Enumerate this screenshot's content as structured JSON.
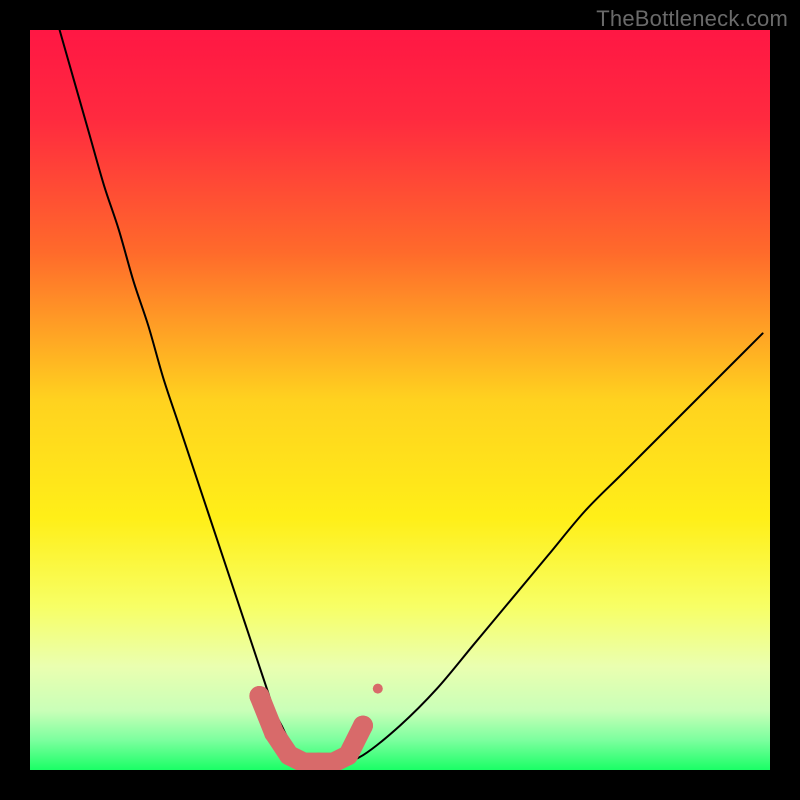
{
  "watermark": "TheBottleneck.com",
  "chart_data": {
    "type": "line",
    "title": "",
    "xlabel": "",
    "ylabel": "",
    "xlim": [
      0,
      100
    ],
    "ylim": [
      0,
      100
    ],
    "grid": false,
    "legend": false,
    "background_gradient": [
      {
        "stop": 0.0,
        "color": "#ff1744"
      },
      {
        "stop": 0.12,
        "color": "#ff2a3f"
      },
      {
        "stop": 0.3,
        "color": "#ff6a2b"
      },
      {
        "stop": 0.5,
        "color": "#ffd21f"
      },
      {
        "stop": 0.66,
        "color": "#ffef18"
      },
      {
        "stop": 0.78,
        "color": "#f7ff66"
      },
      {
        "stop": 0.86,
        "color": "#eaffb0"
      },
      {
        "stop": 0.92,
        "color": "#c9ffb8"
      },
      {
        "stop": 0.96,
        "color": "#7bff9e"
      },
      {
        "stop": 1.0,
        "color": "#1aff66"
      }
    ],
    "series": [
      {
        "name": "bottleneck-curve",
        "stroke": "#000000",
        "stroke_width": 2,
        "x": [
          4,
          6,
          8,
          10,
          12,
          14,
          16,
          18,
          20,
          22,
          24,
          26,
          28,
          29,
          30,
          31,
          32,
          33,
          34,
          35,
          36,
          37,
          38,
          39,
          40,
          42,
          45,
          50,
          55,
          60,
          65,
          70,
          75,
          80,
          85,
          90,
          95,
          99
        ],
        "values": [
          100,
          93,
          86,
          79,
          73,
          66,
          60,
          53,
          47,
          41,
          35,
          29,
          23,
          20,
          17,
          14,
          11,
          8,
          6,
          4,
          2.5,
          1.5,
          1.0,
          0.8,
          0.8,
          0.9,
          2,
          6,
          11,
          17,
          23,
          29,
          35,
          40,
          45,
          50,
          55,
          59
        ]
      }
    ],
    "highlight": {
      "name": "trough-marker",
      "color": "#d86a6a",
      "radius": 10,
      "x": [
        31,
        33,
        35,
        37,
        39,
        41,
        43,
        45
      ],
      "values": [
        10,
        5,
        2,
        1,
        1,
        1,
        2,
        6
      ]
    },
    "highlight_dot": {
      "name": "trough-outlier",
      "color": "#d86a6a",
      "radius": 5,
      "x": 47,
      "value": 11
    }
  }
}
